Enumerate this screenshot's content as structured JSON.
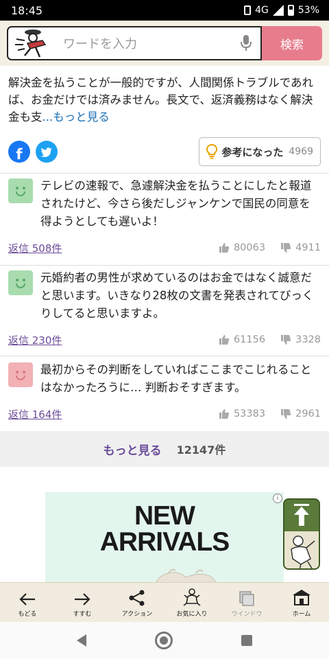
{
  "status": {
    "time": "18:45",
    "network": "4G",
    "battery": "53%"
  },
  "search": {
    "placeholder": "ワードを入力",
    "button": "検索"
  },
  "article": {
    "text": "解決金を払うことが一般的ですが、人間関係トラブルであれば、お金だけでは済みません。長文で、返済義務はなく解決金も支",
    "more": "...もっと見る"
  },
  "helpful": {
    "label": "参考になった",
    "count": "4969"
  },
  "comments": [
    {
      "text": "テレビの速報で、急遽解決金を払うことにしたと報道されたけど、今さら後だしジャンケンで国民の同意を得ようとしても遅いよ！",
      "reply": "返信 508件",
      "likes": "80063",
      "dislikes": "4911",
      "face": "green"
    },
    {
      "text": "元婚約者の男性が求めているのはお金ではなく誠意だと思います。いきなり28枚の文書を発表されてびっくりしてると思いますよ。",
      "reply": "返信 230件",
      "likes": "61156",
      "dislikes": "3328",
      "face": "green"
    },
    {
      "text": "最初からその判断をしていればここまでこじれることはなかったろうに… 判断おそすぎます。",
      "reply": "返信 164件",
      "likes": "53383",
      "dislikes": "2961",
      "face": "pink"
    }
  ],
  "more_comments": {
    "label": "もっと見る",
    "count": "12147件"
  },
  "ad": {
    "line1": "NEW",
    "line2": "ARRIVALS"
  },
  "toolbar": [
    {
      "label": "もどる",
      "icon": "back-arrow-icon"
    },
    {
      "label": "すすむ",
      "icon": "forward-arrow-icon"
    },
    {
      "label": "アクション",
      "icon": "share-icon"
    },
    {
      "label": "お気に入り",
      "icon": "frog-icon"
    },
    {
      "label": "ウインドウ",
      "icon": "window-icon"
    },
    {
      "label": "ホーム",
      "icon": "home-icon"
    }
  ],
  "colors": {
    "search_button": "#e77d8c",
    "reply_link": "#6b4b9a",
    "more_link_blue": "#1a6fb5",
    "toolbar_bg": "#f1ecdf"
  }
}
